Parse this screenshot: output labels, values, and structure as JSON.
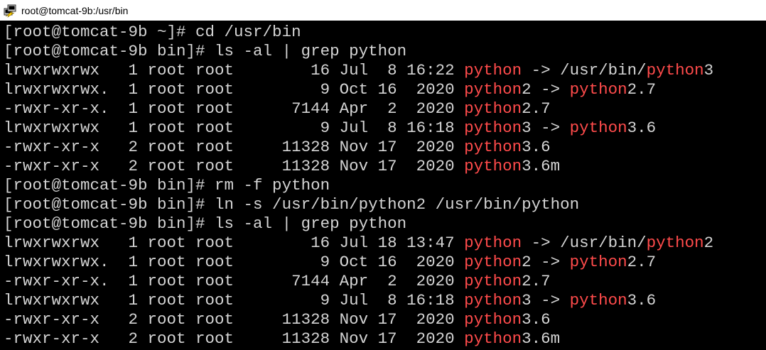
{
  "window": {
    "title": "root@tomcat-9b:/usr/bin"
  },
  "colors": {
    "background": "#000000",
    "text": "#d4d4d4",
    "highlight": "#ff4b4b"
  },
  "terminal": {
    "lines": [
      [
        {
          "t": "[root@tomcat-9b ~]# cd /usr/bin"
        }
      ],
      [
        {
          "t": "[root@tomcat-9b bin]# ls -al | grep python"
        }
      ],
      [
        {
          "t": "lrwxrwxrwx   1 root root        16 Jul  8 16:22 "
        },
        {
          "t": "python",
          "h": true
        },
        {
          "t": " -> /usr/bin/"
        },
        {
          "t": "python",
          "h": true
        },
        {
          "t": "3"
        }
      ],
      [
        {
          "t": "lrwxrwxrwx.  1 root root         9 Oct 16  2020 "
        },
        {
          "t": "python",
          "h": true
        },
        {
          "t": "2 -> "
        },
        {
          "t": "python",
          "h": true
        },
        {
          "t": "2.7"
        }
      ],
      [
        {
          "t": "-rwxr-xr-x.  1 root root      7144 Apr  2  2020 "
        },
        {
          "t": "python",
          "h": true
        },
        {
          "t": "2.7"
        }
      ],
      [
        {
          "t": "lrwxrwxrwx   1 root root         9 Jul  8 16:18 "
        },
        {
          "t": "python",
          "h": true
        },
        {
          "t": "3 -> "
        },
        {
          "t": "python",
          "h": true
        },
        {
          "t": "3.6"
        }
      ],
      [
        {
          "t": "-rwxr-xr-x   2 root root     11328 Nov 17  2020 "
        },
        {
          "t": "python",
          "h": true
        },
        {
          "t": "3.6"
        }
      ],
      [
        {
          "t": "-rwxr-xr-x   2 root root     11328 Nov 17  2020 "
        },
        {
          "t": "python",
          "h": true
        },
        {
          "t": "3.6m"
        }
      ],
      [
        {
          "t": "[root@tomcat-9b bin]# rm -f python"
        }
      ],
      [
        {
          "t": "[root@tomcat-9b bin]# ln -s /usr/bin/python2 /usr/bin/python"
        }
      ],
      [
        {
          "t": "[root@tomcat-9b bin]# ls -al | grep python"
        }
      ],
      [
        {
          "t": "lrwxrwxrwx   1 root root        16 Jul 18 13:47 "
        },
        {
          "t": "python",
          "h": true
        },
        {
          "t": " -> /usr/bin/"
        },
        {
          "t": "python",
          "h": true
        },
        {
          "t": "2"
        }
      ],
      [
        {
          "t": "lrwxrwxrwx.  1 root root         9 Oct 16  2020 "
        },
        {
          "t": "python",
          "h": true
        },
        {
          "t": "2 -> "
        },
        {
          "t": "python",
          "h": true
        },
        {
          "t": "2.7"
        }
      ],
      [
        {
          "t": "-rwxr-xr-x.  1 root root      7144 Apr  2  2020 "
        },
        {
          "t": "python",
          "h": true
        },
        {
          "t": "2.7"
        }
      ],
      [
        {
          "t": "lrwxrwxrwx   1 root root         9 Jul  8 16:18 "
        },
        {
          "t": "python",
          "h": true
        },
        {
          "t": "3 -> "
        },
        {
          "t": "python",
          "h": true
        },
        {
          "t": "3.6"
        }
      ],
      [
        {
          "t": "-rwxr-xr-x   2 root root     11328 Nov 17  2020 "
        },
        {
          "t": "python",
          "h": true
        },
        {
          "t": "3.6"
        }
      ],
      [
        {
          "t": "-rwxr-xr-x   2 root root     11328 Nov 17  2020 "
        },
        {
          "t": "python",
          "h": true
        },
        {
          "t": "3.6m"
        }
      ]
    ]
  }
}
